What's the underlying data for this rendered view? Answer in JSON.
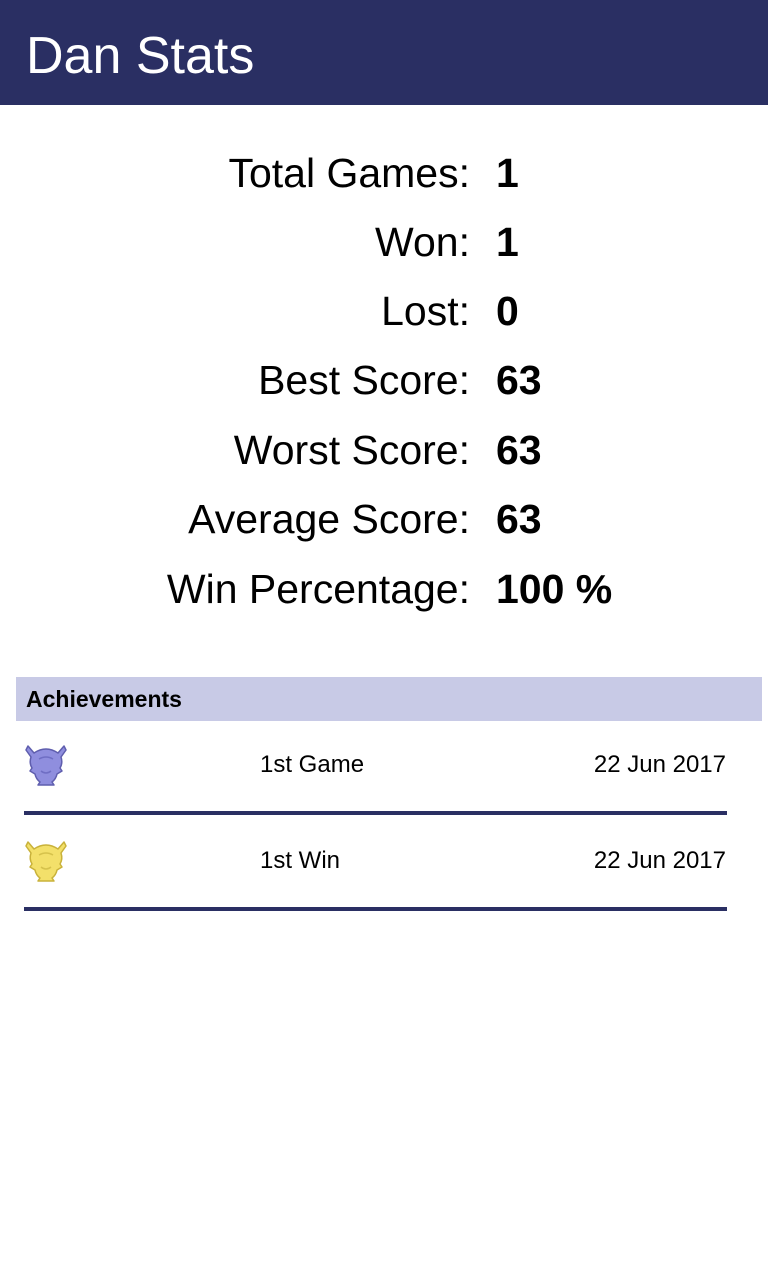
{
  "header": {
    "title": "Dan Stats"
  },
  "stats": [
    {
      "label": "Total Games:",
      "value": "1"
    },
    {
      "label": "Won:",
      "value": "1"
    },
    {
      "label": "Lost:",
      "value": "0"
    },
    {
      "label": "Best Score:",
      "value": "63"
    },
    {
      "label": "Worst Score:",
      "value": "63"
    },
    {
      "label": "Average Score:",
      "value": "63"
    },
    {
      "label": "Win Percentage:",
      "value": "100 %"
    }
  ],
  "achievements": {
    "title": "Achievements",
    "items": [
      {
        "name": "1st Game",
        "date": "22 Jun 2017",
        "icon": "purple-trophy-icon",
        "color": "#8f8ede"
      },
      {
        "name": "1st Win",
        "date": "22 Jun 2017",
        "icon": "gold-trophy-icon",
        "color": "#f3e06a"
      }
    ]
  },
  "colors": {
    "header_bg": "#2a2f63",
    "section_bg": "#c8cae6",
    "divider": "#2a2f63"
  }
}
